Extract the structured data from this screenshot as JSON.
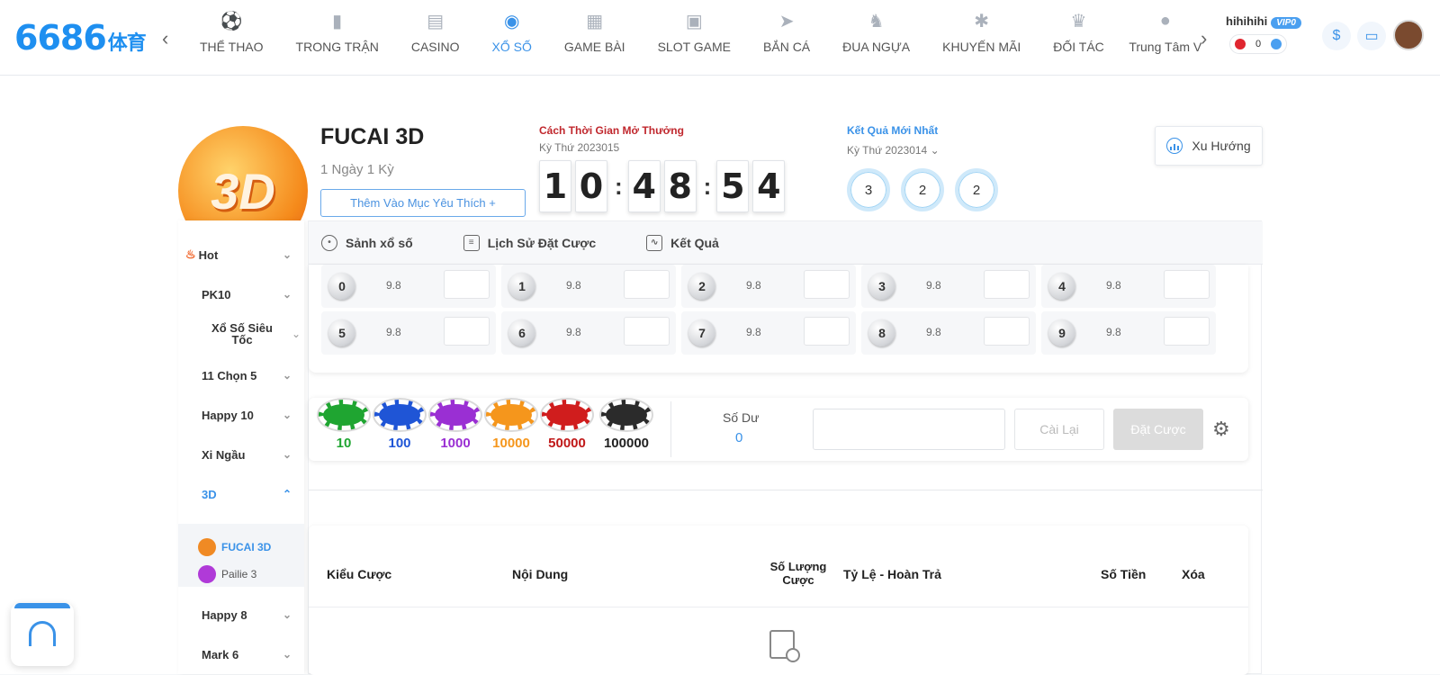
{
  "header": {
    "logo": "6686",
    "logo_sub": "体育",
    "nav": [
      {
        "label": "THỂ THAO",
        "icon": "soccer-ball-icon"
      },
      {
        "label": "TRONG TRẬN",
        "icon": "video-camera-icon"
      },
      {
        "label": "CASINO",
        "icon": "cards-icon"
      },
      {
        "label": "XỔ SỐ",
        "icon": "lottery-ball-icon",
        "active": true
      },
      {
        "label": "GAME BÀI",
        "icon": "playing-card-icon"
      },
      {
        "label": "SLOT GAME",
        "icon": "slot-machine-icon"
      },
      {
        "label": "BẮN CÁ",
        "icon": "fish-icon"
      },
      {
        "label": "ĐUA NGỰA",
        "icon": "horse-icon"
      },
      {
        "label": "KHUYẾN MÃI",
        "icon": "percent-badge-icon"
      },
      {
        "label": "ĐỐI TÁC",
        "icon": "crown-icon"
      },
      {
        "label": "Trung Tâm V",
        "icon": "user-icon"
      }
    ],
    "username": "hihihihi",
    "vip": "VIP0",
    "balance": "0"
  },
  "game": {
    "title": "FUCAI 3D",
    "badge_text": "3D",
    "frequency": "1 Ngày 1 Kỳ",
    "favorite_label": "Thêm Vào Mục Yêu Thích +",
    "countdown_label": "Cách Thời Gian Mở Thưởng",
    "countdown_period": "Kỳ Thứ 2023015",
    "countdown": [
      "1",
      "0",
      "4",
      "8",
      "5",
      "4"
    ],
    "result_label": "Kết Quả Mới Nhất",
    "result_period": "Kỳ Thứ 2023014",
    "results": [
      "3",
      "2",
      "2"
    ],
    "trend_label": "Xu Hướng"
  },
  "sidebar": {
    "items": [
      {
        "label": "Hot"
      },
      {
        "label": "PK10"
      },
      {
        "label": "Xổ Số Siêu Tốc"
      },
      {
        "label": "11 Chọn 5"
      },
      {
        "label": "Happy 10"
      },
      {
        "label": "Xi Ngầu"
      },
      {
        "label": "3D",
        "active": true
      },
      {
        "label": "Happy 8"
      },
      {
        "label": "Mark 6"
      }
    ],
    "sub_items": [
      {
        "label": "FUCAI 3D",
        "color": "#f08a24",
        "active": true
      },
      {
        "label": "Pailie 3",
        "color": "#b03ad8"
      }
    ]
  },
  "tabs": [
    {
      "label": "Sảnh xổ số"
    },
    {
      "label": "Lịch Sử Đặt Cược"
    },
    {
      "label": "Kết Quả"
    }
  ],
  "board": {
    "cells": [
      {
        "num": "0",
        "odd": "9.8"
      },
      {
        "num": "1",
        "odd": "9.8"
      },
      {
        "num": "2",
        "odd": "9.8"
      },
      {
        "num": "3",
        "odd": "9.8"
      },
      {
        "num": "4",
        "odd": "9.8"
      },
      {
        "num": "5",
        "odd": "9.8"
      },
      {
        "num": "6",
        "odd": "9.8"
      },
      {
        "num": "7",
        "odd": "9.8"
      },
      {
        "num": "8",
        "odd": "9.8"
      },
      {
        "num": "9",
        "odd": "9.8"
      }
    ]
  },
  "chips": [
    {
      "label": "10",
      "color": "#1fa531"
    },
    {
      "label": "100",
      "color": "#1f55d6"
    },
    {
      "label": "1000",
      "color": "#9a2fd3"
    },
    {
      "label": "10000",
      "color": "#f5961c"
    },
    {
      "label": "50000",
      "color": "#d01d1d"
    },
    {
      "label": "100000",
      "color": "#2b2b2b"
    }
  ],
  "betbar": {
    "balance_label": "Số Dư",
    "balance_value": "0",
    "reset_label": "Cài Lại",
    "place_label": "Đặt Cược"
  },
  "slip": {
    "headers": [
      "Kiểu Cược",
      "Nội Dung",
      "Số Lượng Cược",
      "Tỷ Lệ - Hoàn Trả",
      "Số Tiền",
      "Xóa"
    ]
  },
  "colors": {
    "accent": "#3a92e8",
    "countdown_label": "#c0272d"
  }
}
